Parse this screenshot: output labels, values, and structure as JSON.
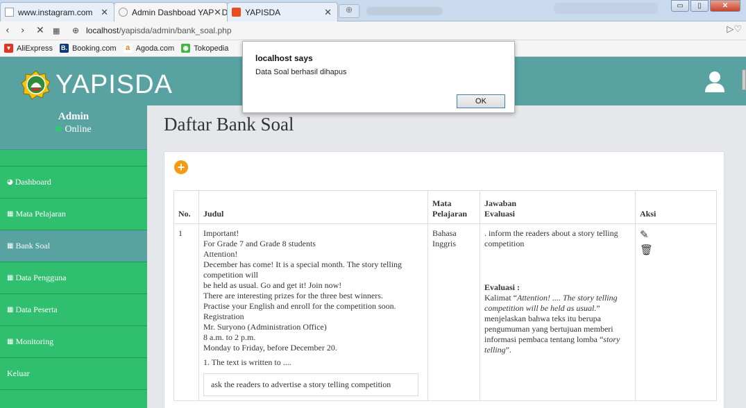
{
  "browser": {
    "tabs": [
      {
        "title": "www.instagram.com"
      },
      {
        "title": "Admin Dashboad YAPISDA"
      },
      {
        "title": "YAPISDA"
      }
    ],
    "url_host": "localhost",
    "url_path": "/yapisda/admin/bank_soal.php",
    "bookmarks": [
      {
        "label": "AliExpress",
        "color": "#e43225"
      },
      {
        "label": "Booking.com",
        "color": "#0c3b7c",
        "glyph": "B."
      },
      {
        "label": "Agoda.com",
        "color": "#ffffff"
      },
      {
        "label": "Tokopedia",
        "color": "#42b549"
      }
    ]
  },
  "dialog": {
    "title": "localhost says",
    "message": "Data Soal berhasil dihapus",
    "ok_label": "OK"
  },
  "header": {
    "brand": "YAPISDA",
    "accent": "#58a3a1"
  },
  "sidebar": {
    "user_name": "Admin",
    "user_status": "Online",
    "items": [
      {
        "label": "Dashboard",
        "icon": "dashboard-icon"
      },
      {
        "label": "Mata Pelajaran",
        "icon": "table-icon"
      },
      {
        "label": "Bank Soal",
        "icon": "table-icon"
      },
      {
        "label": "Data Pengguna",
        "icon": "table-icon"
      },
      {
        "label": "Data Peserta",
        "icon": "table-icon"
      },
      {
        "label": "Monitoring",
        "icon": "table-icon"
      },
      {
        "label": "Keluar",
        "icon": ""
      }
    ],
    "color": "#2fbf6e"
  },
  "main": {
    "title": "Daftar Bank Soal",
    "table": {
      "headers": [
        "No.",
        "Judul",
        "Mata Pelajaran",
        "Jawaban Evaluasi",
        "Aksi"
      ],
      "header_mata_1": "Mata",
      "header_mata_2": "Pelajaran",
      "header_jawaban_1": "Jawaban",
      "header_jawaban_2": "Evaluasi",
      "row": {
        "no": "1",
        "judul_lines": [
          "Important!",
          "For Grade 7 and Grade 8 students",
          "Attention!",
          "December has come! It is a special month. The story telling competition will",
          "be held as usual. Go and get it! Join now!",
          "There are interesting prizes for the three best winners.",
          "Practise your English and enroll for the competition soon.",
          "Registration",
          "Mr. Suryono (Administration Office)",
          "8 a.m. to 2 p.m.",
          "Monday to Friday, before December 20."
        ],
        "question": "1. The text is written to ....",
        "option_1": "ask the readers to advertise a story telling competition",
        "mata_pelajaran": "Bahasa Inggris",
        "jawaban": ". inform the readers about a story telling competition",
        "evaluasi_label": "Evaluasi :",
        "evaluasi_prefix": "Kalimat “",
        "evaluasi_quote": "Attention! .... The story telling competition will be held as usual.",
        "evaluasi_mid": "” menjelaskan bahwa teks itu berupa pengumuman yang bertujuan memberi informasi pembaca tentang lomba “",
        "evaluasi_term": "story telling",
        "evaluasi_end": "”."
      }
    }
  }
}
